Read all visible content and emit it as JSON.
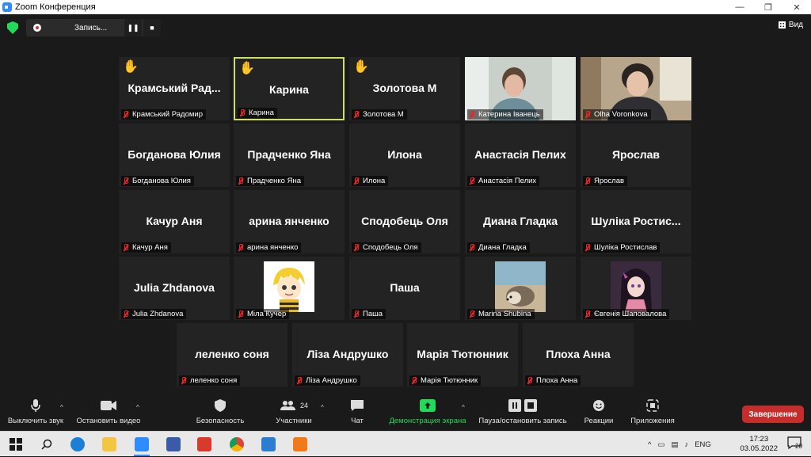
{
  "window": {
    "title": "Zoom Конференция"
  },
  "topbar": {
    "recording_label": "Запись...",
    "view_label": "Вид"
  },
  "tiles": [
    {
      "big": "Крамський Рад...",
      "caption": "Крамський Радомир",
      "hand": true
    },
    {
      "big": "Карина",
      "caption": "Карина",
      "hand": true,
      "active": true
    },
    {
      "big": "Золотова М",
      "caption": "Золотова М",
      "hand": true
    },
    {
      "big": "",
      "caption": "Катерина Іванець",
      "video": "katerina"
    },
    {
      "big": "",
      "caption": "Olha Voronkova",
      "video": "olha"
    },
    {
      "big": "Богданова Юлия",
      "caption": "Богданова Юлия"
    },
    {
      "big": "Прадченко Яна",
      "caption": "Прадченко Яна"
    },
    {
      "big": "Илона",
      "caption": "Илона"
    },
    {
      "big": "Анастасія Пелих",
      "caption": "Анастасія Пелих"
    },
    {
      "big": "Ярослав",
      "caption": "Ярослав"
    },
    {
      "big": "Качур Аня",
      "caption": "Качур Аня"
    },
    {
      "big": "арина янченко",
      "caption": "арина янченко"
    },
    {
      "big": "Сподобець Оля",
      "caption": "Сподобець Оля"
    },
    {
      "big": "Диана Гладка",
      "caption": "Диана Гладка"
    },
    {
      "big": "Шуліка Ростис...",
      "caption": "Шуліка Ростислав"
    },
    {
      "big": "Julia Zhdanova",
      "caption": "Julia Zhdanova"
    },
    {
      "big": "",
      "caption": "Міла Кучер",
      "avatar": "cartoon"
    },
    {
      "big": "Паша",
      "caption": "Паша"
    },
    {
      "big": "",
      "caption": "Marina Shubina",
      "avatar": "hedgehog"
    },
    {
      "big": "",
      "caption": "Євгенія Шаповалова",
      "avatar": "anime"
    },
    {
      "big": "леленко соня",
      "caption": "леленко соня"
    },
    {
      "big": "Ліза Андрушко",
      "caption": "Ліза Андрушко"
    },
    {
      "big": "Марія  Тютюнник",
      "caption": "Марія Тютюнник"
    },
    {
      "big": "Плоха Анна",
      "caption": "Плоха Анна"
    }
  ],
  "toolbar": {
    "mute_label": "Выключить звук",
    "video_label": "Остановить видео",
    "security_label": "Безопасность",
    "participants_label": "Участники",
    "participants_count": "24",
    "chat_label": "Чат",
    "share_label": "Демонстрация экрана",
    "record_label": "Пауза/остановить запись",
    "reactions_label": "Реакции",
    "apps_label": "Приложения",
    "end_label": "Завершение"
  },
  "taskbar": {
    "lang": "ENG",
    "time": "17:23",
    "date": "03.05.2022",
    "notifications": "20"
  }
}
